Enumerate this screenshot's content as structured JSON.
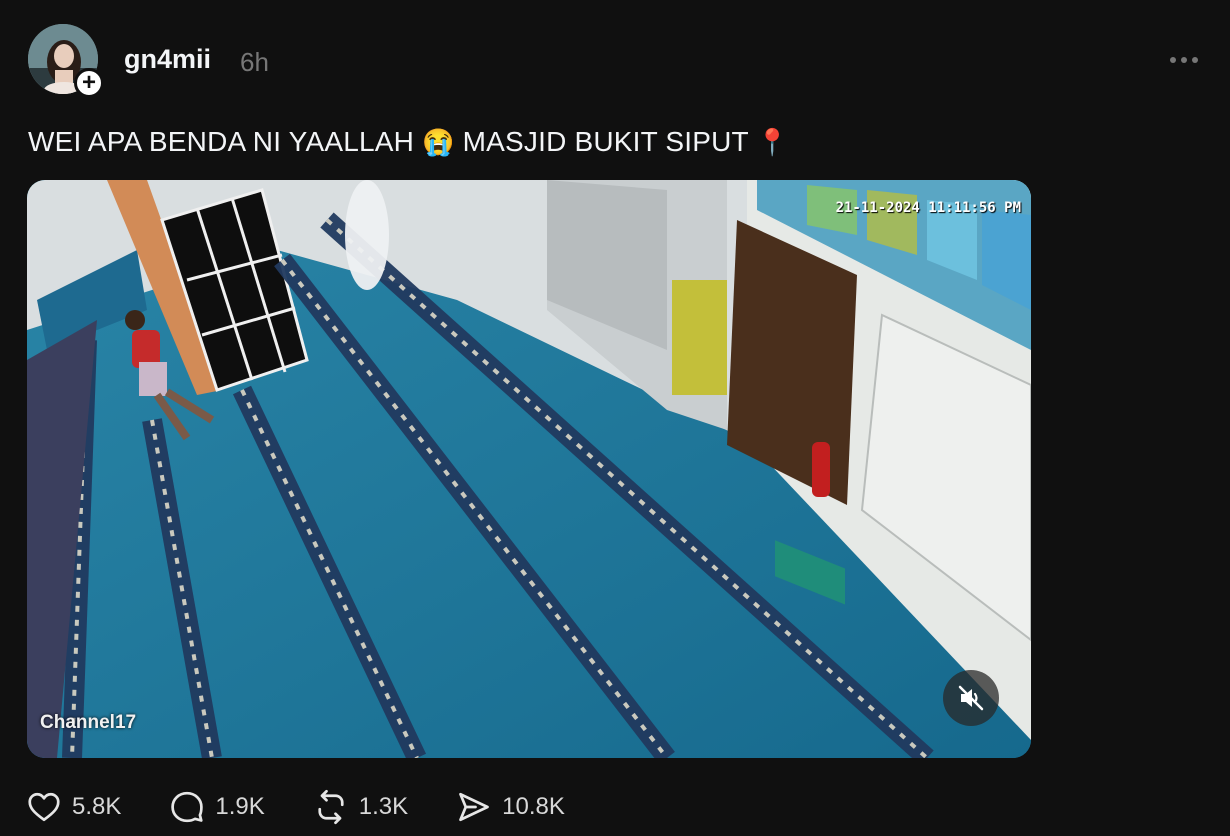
{
  "post": {
    "username": "gn4mii",
    "time_ago": "6h",
    "caption": "WEI APA BENDA NI YAALLAH",
    "caption_emoji": "😭",
    "caption_tail": "MASJID BUKIT SIPUT",
    "caption_tail_emoji": "📍"
  },
  "media": {
    "watermark": "Channel17",
    "cctv_stamp": "21-11-2024 11:11:56 PM",
    "mute_state": "muted"
  },
  "actions": {
    "likes": "5.8K",
    "replies": "1.9K",
    "reposts": "1.3K",
    "shares": "10.8K"
  },
  "icons": {
    "more": "more-horizontal-icon",
    "like": "heart-icon",
    "reply": "speech-bubble-icon",
    "repost": "repost-arrows-icon",
    "share": "send-icon",
    "follow": "plus-icon",
    "mute": "speaker-muted-icon"
  }
}
